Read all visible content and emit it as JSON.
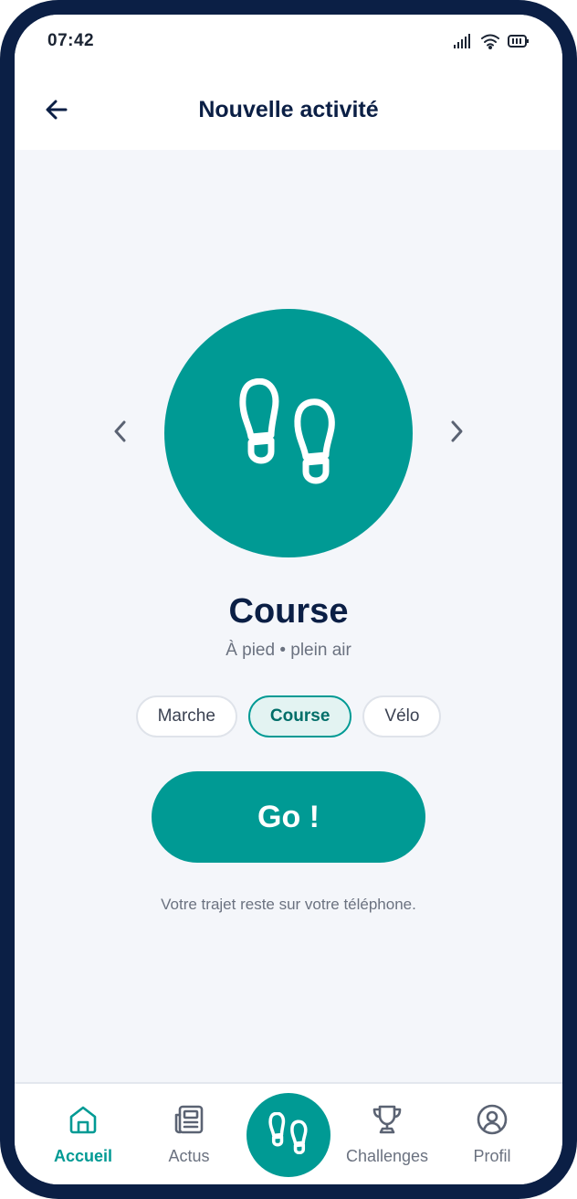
{
  "status_bar": {
    "time": "07:42"
  },
  "header": {
    "title": "Nouvelle activité"
  },
  "activity": {
    "name": "Course",
    "subtitle": "À pied • plein air",
    "icon": "footprints-icon"
  },
  "activity_chips": [
    {
      "label": "Marche",
      "selected": false
    },
    {
      "label": "Course",
      "selected": true
    },
    {
      "label": "Vélo",
      "selected": false
    }
  ],
  "go_button": {
    "label": "Go !"
  },
  "privacy_note": "Votre trajet reste sur votre téléphone.",
  "bottom_nav": {
    "items": [
      {
        "label": "Accueil",
        "icon": "home-icon",
        "active": true
      },
      {
        "label": "Actus",
        "icon": "newspaper-icon",
        "active": false
      },
      {
        "label": "Challenges",
        "icon": "trophy-icon",
        "active": false
      },
      {
        "label": "Profil",
        "icon": "user-circle-icon",
        "active": false
      }
    ],
    "center_icon": "footprints-icon"
  },
  "colors": {
    "accent": "#009a94",
    "navy": "#0b1f45",
    "background": "#f4f6fa",
    "chip_selected_bg": "#e3f3f2"
  }
}
